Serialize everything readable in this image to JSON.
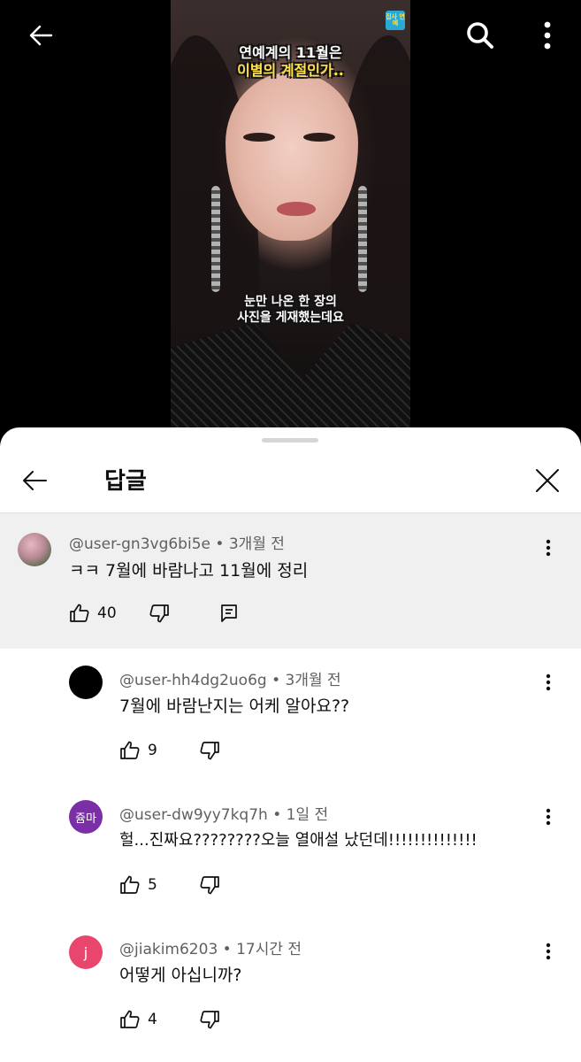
{
  "video": {
    "caption_top_line1": "연예계의 11월은",
    "caption_top_line2": "이별의 계절인가..",
    "caption_bottom_line1": "눈만 나온 한 장의",
    "caption_bottom_line2": "사진을 게재했는데요",
    "channel_logo": "집사 연예"
  },
  "sheet": {
    "title": "답글"
  },
  "parent_comment": {
    "author": "@user-gn3vg6bi5e",
    "time": "3개월 전",
    "text": "ㅋㅋ 7월에 바람나고 11월에 정리",
    "likes": "40"
  },
  "replies": [
    {
      "author": "@user-hh4dg2uo6g",
      "time": "3개월 전",
      "text": "7월에 바람난지는 어케 알아요??",
      "likes": "9",
      "avatar_color": "#000000",
      "avatar_text": ""
    },
    {
      "author": "@user-dw9yy7kq7h",
      "time": "1일 전",
      "text": "헐...진짜요????????오늘 열애설 났던데!!!!!!!!!!!!!!",
      "likes": "5",
      "avatar_color": "#7b2fa6",
      "avatar_text": "쥼마"
    },
    {
      "author": "@jiakim6203",
      "time": "17시간 전",
      "text": "어떻게 아십니까?",
      "likes": "4",
      "avatar_color": "#e8466d",
      "avatar_text": "j"
    }
  ],
  "separator": "•",
  "icons": {
    "back": "arrow-left-icon",
    "search": "search-icon",
    "more": "more-vertical-icon",
    "close": "close-icon",
    "like": "thumbs-up-icon",
    "dislike": "thumbs-down-icon",
    "reply": "reply-comment-icon"
  }
}
